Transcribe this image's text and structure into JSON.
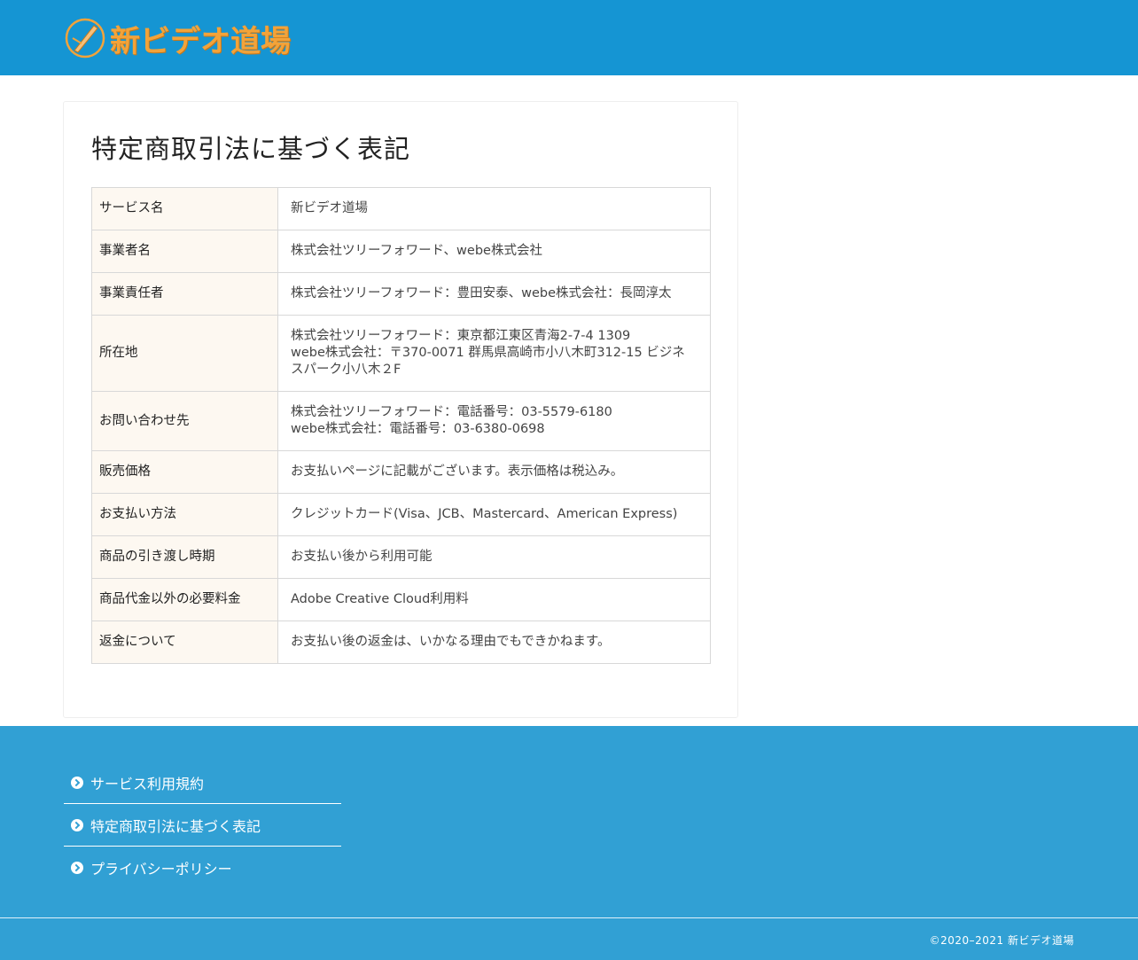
{
  "header": {
    "logo_text": "新ビデオ道場",
    "colors": {
      "bar": "#1595d3",
      "logo": "#f2a33a"
    }
  },
  "main": {
    "title": "特定商取引法に基づく表記",
    "rows": [
      {
        "label": "サービス名",
        "lines": [
          "新ビデオ道場"
        ]
      },
      {
        "label": "事業者名",
        "lines": [
          "株式会社ツリーフォワード、webe株式会社"
        ]
      },
      {
        "label": "事業責任者",
        "lines": [
          "株式会社ツリーフォワード：豊田安泰、webe株式会社：長岡淳太"
        ]
      },
      {
        "label": "所在地",
        "lines": [
          "株式会社ツリーフォワード：東京都江東区青海2-7-4 1309",
          "webe株式会社：〒370-0071 群馬県高崎市小八木町312-15 ビジネスパーク小八木２F"
        ]
      },
      {
        "label": "お問い合わせ先",
        "lines": [
          "株式会社ツリーフォワード：電話番号：03-5579-6180",
          "webe株式会社：電話番号：03-6380-0698"
        ]
      },
      {
        "label": "販売価格",
        "lines": [
          "お支払いページに記載がございます。表示価格は税込み。"
        ]
      },
      {
        "label": "お支払い方法",
        "lines": [
          "クレジットカード(Visa、JCB、Mastercard、American Express)"
        ]
      },
      {
        "label": "商品の引き渡し時期",
        "lines": [
          "お支払い後から利用可能"
        ]
      },
      {
        "label": "商品代金以外の必要料金",
        "lines": [
          "Adobe Creative Cloud利用料"
        ]
      },
      {
        "label": "返金について",
        "lines": [
          "お支払い後の返金は、いかなる理由でもできかねます。"
        ]
      }
    ]
  },
  "footer": {
    "links": [
      {
        "label": "サービス利用規約",
        "icon": "chevron-circle-right-icon"
      },
      {
        "label": "特定商取引法に基づく表記",
        "icon": "chevron-circle-right-icon"
      },
      {
        "label": "プライバシーポリシー",
        "icon": "chevron-circle-right-icon"
      }
    ],
    "copyright": "©2020–2021  新ビデオ道場",
    "colors": {
      "bg": "#31a0d4"
    }
  }
}
